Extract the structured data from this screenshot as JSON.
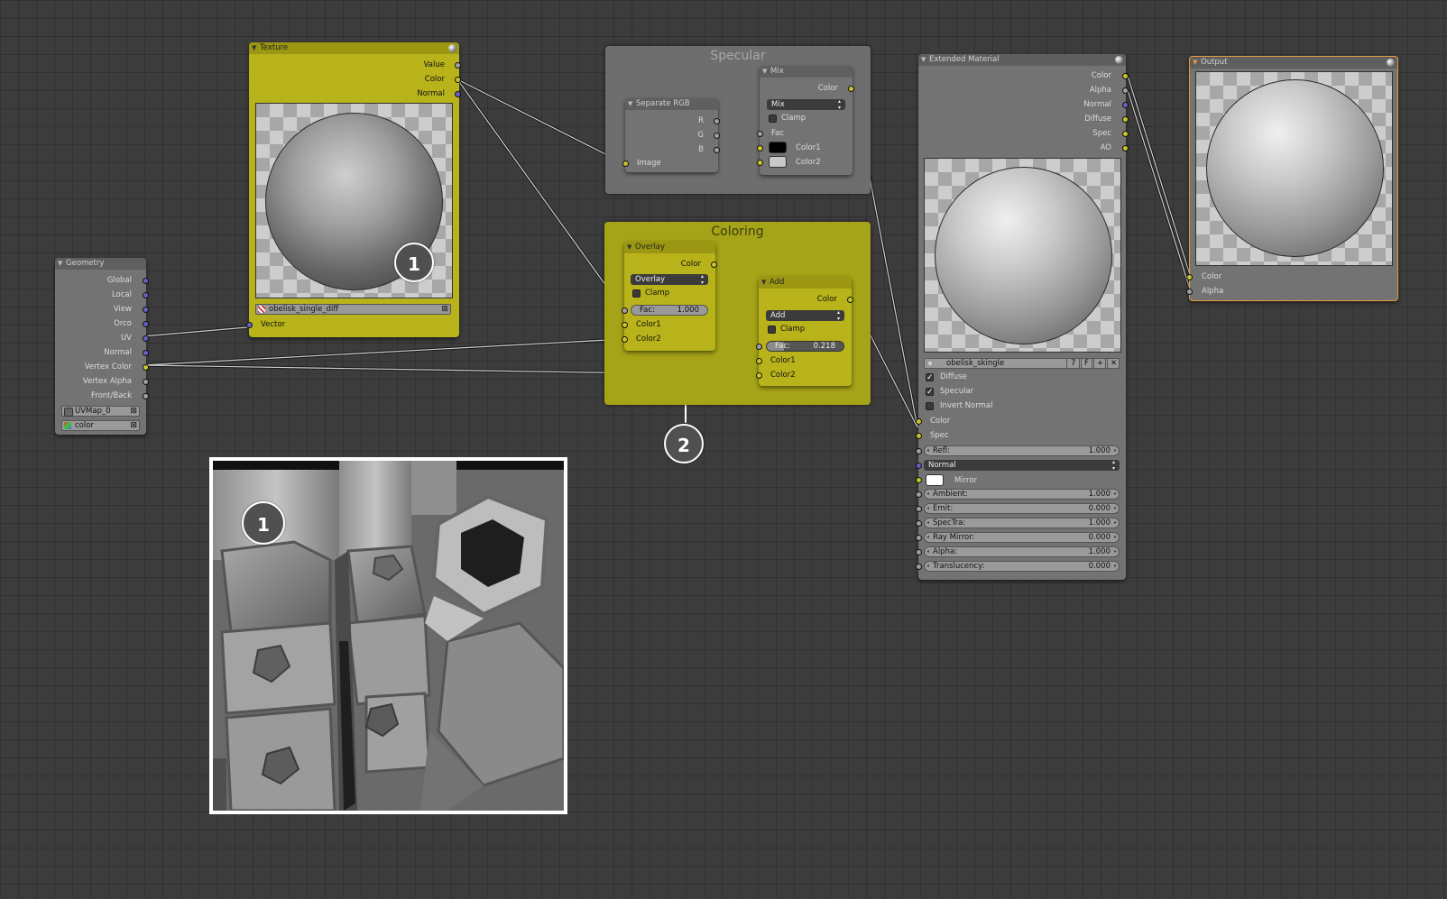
{
  "frames": {
    "specular": {
      "label": "Specular"
    },
    "coloring": {
      "label": "Coloring"
    }
  },
  "geometry": {
    "title": "Geometry",
    "outputs": [
      "Global",
      "Local",
      "View",
      "Orco",
      "UV",
      "Normal",
      "Vertex Color",
      "Vertex Alpha",
      "Front/Back"
    ],
    "uv_map": "UVMap_0",
    "color_layer": "color"
  },
  "texture": {
    "title": "Texture",
    "outputs": [
      "Value",
      "Color",
      "Normal"
    ],
    "image_name": "obelisk_single_diff",
    "input": "Vector"
  },
  "separate_rgb": {
    "title": "Separate RGB",
    "outputs": [
      "R",
      "G",
      "B"
    ],
    "input": "Image"
  },
  "mix": {
    "title": "Mix",
    "output": "Color",
    "blend": "Mix",
    "clamp": "Clamp",
    "fac": "Fac",
    "color1": "Color1",
    "color2": "Color2",
    "color1_swatch": "#000000",
    "color2_swatch": "#c8c8c8"
  },
  "overlay": {
    "title": "Overlay",
    "output": "Color",
    "blend": "Overlay",
    "clamp": "Clamp",
    "fac_label": "Fac:",
    "fac_value": "1.000",
    "color1": "Color1",
    "color2": "Color2"
  },
  "add": {
    "title": "Add",
    "output": "Color",
    "blend": "Add",
    "clamp": "Clamp",
    "fac_label": "Fac:",
    "fac_value": "0.218",
    "fac_fraction": 0.218,
    "color1": "Color1",
    "color2": "Color2"
  },
  "extended_material": {
    "title": "Extended Material",
    "outputs": [
      "Color",
      "Alpha",
      "Normal",
      "Diffuse",
      "Spec",
      "AO"
    ],
    "material_name": "obelisk_skingle",
    "users": "7",
    "fake": "F",
    "checks": [
      {
        "label": "Diffuse",
        "checked": true
      },
      {
        "label": "Specular",
        "checked": true
      },
      {
        "label": "Invert Normal",
        "checked": false
      }
    ],
    "inputs_color": "Color",
    "inputs_spec": "Spec",
    "refl_label": "Refl:",
    "refl_value": "1.000",
    "normal_select": "Normal",
    "mirror_label": "Mirror",
    "sliders": [
      {
        "label": "Ambient:",
        "value": "1.000"
      },
      {
        "label": "Emit:",
        "value": "0.000"
      },
      {
        "label": "SpecTra:",
        "value": "1.000"
      },
      {
        "label": "Ray Mirror:",
        "value": "0.000"
      },
      {
        "label": "Alpha:",
        "value": "1.000"
      },
      {
        "label": "Translucency:",
        "value": "0.000"
      }
    ]
  },
  "output": {
    "title": "Output",
    "inputs": [
      "Color",
      "Alpha"
    ]
  },
  "markers": {
    "one": "1",
    "two": "2",
    "inset_one": "1"
  },
  "colors": {
    "node_yellow": "#b8b31b",
    "socket_yellow": "#c7c729",
    "socket_grey": "#a1a1a1",
    "socket_blue": "#6363c7",
    "output_border": "#e59a3c"
  }
}
